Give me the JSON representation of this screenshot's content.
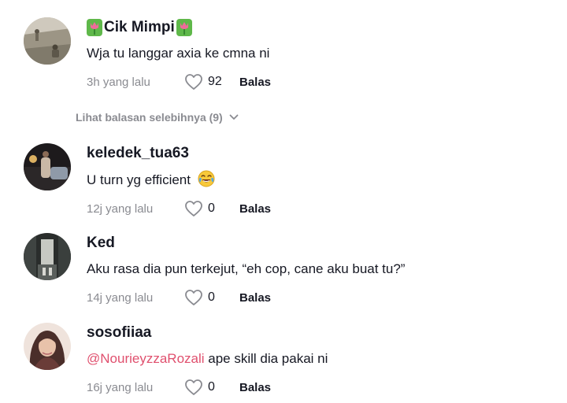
{
  "comments": [
    {
      "username": "Cik Mimpi",
      "text": "Wja tu langgar axia ke cmna ni",
      "time": "3h yang lalu",
      "likes": "92",
      "reply": "Balas"
    },
    {
      "username": "keledek_tua63",
      "text": "U turn yg efficient",
      "time": "12j yang lalu",
      "likes": "0",
      "reply": "Balas"
    },
    {
      "username": "Ked",
      "text": "Aku rasa dia pun terkejut, “eh cop, cane aku buat tu?”",
      "time": "14j yang lalu",
      "likes": "0",
      "reply": "Balas"
    },
    {
      "username": "sosofiiaa",
      "mention": "@NourieyzzaRozali",
      "text": " ape skill dia pakai ni",
      "time": "16j yang lalu",
      "likes": "0",
      "reply": "Balas"
    }
  ],
  "more_replies": "Lihat balasan selebihnya (9)",
  "icons": {
    "like": "heart-outline-icon",
    "expand": "chevron-down-icon",
    "username_decoration": "tulip-icon",
    "emoji": "face-with-tears-of-joy-icon"
  },
  "colors": {
    "mention": "#e0506e",
    "secondary_text": "#8a8b91",
    "primary_text": "#161823"
  }
}
